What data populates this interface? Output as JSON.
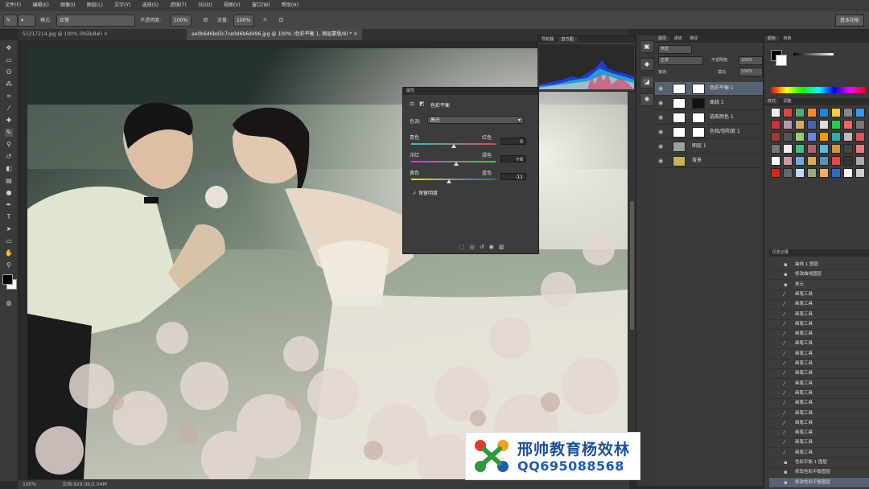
{
  "menu": [
    "文件(F)",
    "编辑(E)",
    "图像(I)",
    "图层(L)",
    "文字(Y)",
    "选择(S)",
    "滤镜(T)",
    "3D(D)",
    "视图(V)",
    "窗口(W)",
    "帮助(H)"
  ],
  "options": {
    "mode_label": "模式:",
    "mode_value": "正常",
    "opacity_label": "不透明度:",
    "opacity_value": "100%",
    "flow_label": "流量:",
    "flow_value": "100%",
    "workspace": "基本功能"
  },
  "tabs": [
    {
      "label": "51217214.jpg @ 100% (RGB/8#) ×"
    },
    {
      "label": "ae0b6d6bd3c7ce0d6b6d496.jpg @ 100% (色彩平衡 1, 图层蒙版/8) * ×"
    }
  ],
  "status": {
    "zoom": "100%",
    "doc": "文档:929.0K/2.04M"
  },
  "histogram": {
    "tabs": [
      "导航器",
      "直方图"
    ]
  },
  "properties": {
    "title": "属性",
    "adjustment_name": "色彩平衡",
    "tone_label": "色调:",
    "tone_value": "高光",
    "sliders": [
      {
        "left": "青色",
        "right": "红色",
        "value": "0",
        "pos": 0.5
      },
      {
        "left": "洋红",
        "right": "绿色",
        "value": "+6",
        "pos": 0.53
      },
      {
        "left": "黄色",
        "right": "蓝色",
        "value": "-11",
        "pos": 0.45
      }
    ],
    "preserve": "保留明度"
  },
  "layers": {
    "tabs": [
      "图层",
      "通道",
      "路径"
    ],
    "kind": "类型",
    "blend": "正常",
    "opacity_label": "不透明度:",
    "opacity_value": "100%",
    "fill_label": "填充:",
    "fill_value": "100%",
    "lock_label": "锁定:",
    "items": [
      {
        "name": "色彩平衡 1",
        "thumb": "#ffffff",
        "mask": "#ffffff",
        "selected": true
      },
      {
        "name": "曲线 1",
        "thumb": "#ffffff",
        "mask": "#111111",
        "selected": false
      },
      {
        "name": "选取颜色 1",
        "thumb": "#ffffff",
        "mask": "#ffffff",
        "selected": false
      },
      {
        "name": "色相/饱和度 1",
        "thumb": "#ffffff",
        "mask": "#ffffff",
        "selected": false
      },
      {
        "name": "图层 1",
        "thumb": "#9aa39a",
        "mask": "",
        "selected": false
      },
      {
        "name": "背景",
        "thumb": "#c9b25a",
        "mask": "",
        "selected": false
      }
    ]
  },
  "swatch_tabs": [
    "颜色",
    "色板"
  ],
  "style_tabs": [
    "样式",
    "调整"
  ],
  "fg_color": "#000000",
  "bg_color": "#ffffff",
  "history": {
    "tabs": [
      "历史记录"
    ],
    "items": [
      "曲线 1 图层",
      "修改曲线图层",
      "单元",
      "画笔工具",
      "画笔工具",
      "画笔工具",
      "画笔工具",
      "画笔工具",
      "画笔工具",
      "画笔工具",
      "画笔工具",
      "画笔工具",
      "画笔工具",
      "画笔工具",
      "画笔工具",
      "画笔工具",
      "画笔工具",
      "画笔工具",
      "画笔工具",
      "画笔工具",
      "色彩平衡 1 图层",
      "修改色彩平衡图层",
      "修改色彩平衡图层"
    ]
  },
  "watermark": {
    "line1": "邢帅教育杨效林",
    "line2": "QQ695088568",
    "colors": [
      "#e53a2c",
      "#f2a01f",
      "#2f9a3c",
      "#1e5bb8"
    ]
  }
}
